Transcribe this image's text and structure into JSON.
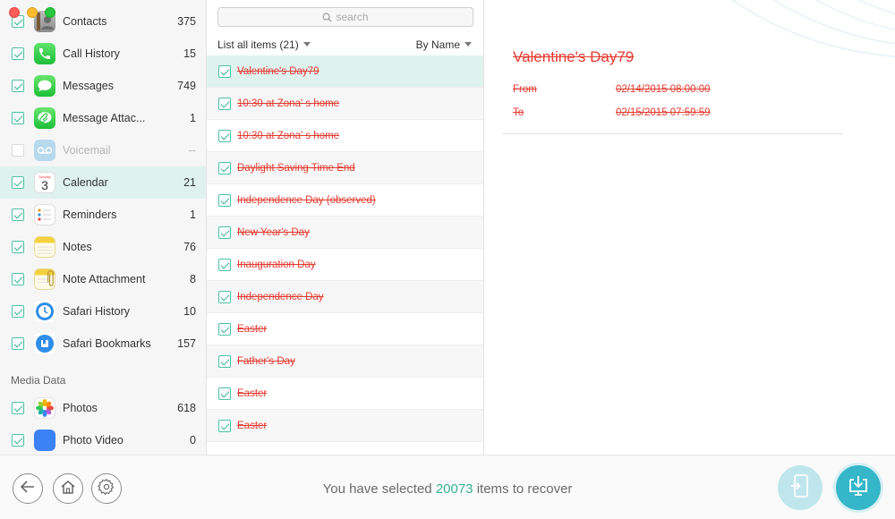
{
  "window": {
    "controls": [
      "close",
      "minimize",
      "zoom"
    ]
  },
  "sidebar": {
    "items": [
      {
        "label": "Contacts",
        "count": "375",
        "checked": true,
        "icon": "contacts-icon"
      },
      {
        "label": "Call History",
        "count": "15",
        "checked": true,
        "icon": "phone-icon"
      },
      {
        "label": "Messages",
        "count": "749",
        "checked": true,
        "icon": "messages-icon"
      },
      {
        "label": "Message Attac...",
        "count": "1",
        "checked": true,
        "icon": "message-attachment-icon"
      },
      {
        "label": "Voicemail",
        "count": "--",
        "checked": false,
        "icon": "voicemail-icon"
      },
      {
        "label": "Calendar",
        "count": "21",
        "checked": true,
        "icon": "calendar-icon",
        "selected": true
      },
      {
        "label": "Reminders",
        "count": "1",
        "checked": true,
        "icon": "reminders-icon"
      },
      {
        "label": "Notes",
        "count": "76",
        "checked": true,
        "icon": "notes-icon"
      },
      {
        "label": "Note Attachment",
        "count": "8",
        "checked": true,
        "icon": "note-attachment-icon"
      },
      {
        "label": "Safari History",
        "count": "10",
        "checked": true,
        "icon": "safari-history-icon"
      },
      {
        "label": "Safari Bookmarks",
        "count": "157",
        "checked": true,
        "icon": "safari-bookmarks-icon"
      }
    ],
    "section_media": "Media Data",
    "media_items": [
      {
        "label": "Photos",
        "count": "618",
        "checked": true,
        "icon": "photos-icon"
      },
      {
        "label": "Photo Video",
        "count": "0",
        "checked": true,
        "icon": "photo-video-icon"
      }
    ],
    "calendar_icon_day": "3",
    "calendar_icon_weekday": "Sunday"
  },
  "list": {
    "search_placeholder": "search",
    "filter_label": "List all items (21)",
    "sort_label": "By Name",
    "items": [
      "Valentine's Day79",
      "10:30 at Zona' s home",
      "10:30 at Zona' s home",
      "Daylight Saving Time End",
      "Independence Day (observed)",
      "New Year's Day",
      "Inauguration Day",
      "Independence Day",
      "Easter",
      "Father's Day",
      "Easter",
      "Easter"
    ]
  },
  "detail": {
    "title": "Valentine's Day79",
    "from_label": "From",
    "from_value": "02/14/2015 08:00:00",
    "to_label": "To",
    "to_value": "02/15/2015 07:59:59"
  },
  "footer": {
    "status_prefix": "You have selected",
    "status_count": "20073",
    "status_suffix": "items to recover",
    "buttons": [
      "back-icon",
      "home-icon",
      "gear-icon",
      "to-device-icon",
      "download-to-computer-icon"
    ]
  },
  "colors": {
    "accent": "#37b293",
    "selection": "#dff2ee",
    "deleted_text": "#e53a2f",
    "download_button": "#35b6c9",
    "device_button": "#bfe6ec"
  }
}
